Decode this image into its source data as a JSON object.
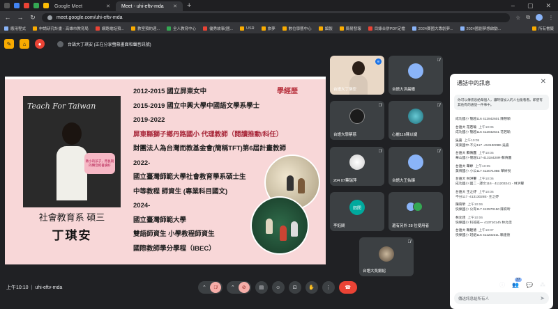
{
  "browser": {
    "tabs": [
      {
        "title": "Google Meet",
        "active": false,
        "favicon": "meet"
      },
      {
        "title": "Meet - uhi-eftv-mda",
        "active": true,
        "favicon": "meet"
      }
    ],
    "url": "meet.google.com/uhi-eftv-mda",
    "bookmarks": [
      "應用程式",
      "申請研究計畫 - 高雄市教育局",
      "網路電話預...",
      "教室預約週...",
      "全人教育中心",
      "優秀故事(國...",
      "USR",
      "旅夢",
      "數位學藝中心",
      "編製",
      "簡易發報",
      "目錄合併PDF定檔",
      "2024賽國大專創夢...",
      "2024國創夢想啟動...",
      "所有書籤"
    ]
  },
  "meet": {
    "presenting_text": "台語大丁琪安 (正在分享螢幕畫面和聲音訊號)",
    "slide": {
      "photo_title": "Teach For Taiwan",
      "sign_text": "教小的孩子，用長期的聲音把書讀好",
      "dept": "社會教育系 碩三",
      "name": "丁琪安",
      "edu_label": "學經歷",
      "lines": [
        {
          "text": "2012-2015 國立屏東女中",
          "red": false
        },
        {
          "text": "2015-2019 國立中興大學中國語文學系學士",
          "red": false
        },
        {
          "text": "2019-2022",
          "red": false
        },
        {
          "text": "屏東縣獅子鄉丹路國小 代理教師（閱讀推動/科任）",
          "red": true
        },
        {
          "text": "財團法人為台灣而教基金會(簡稱TFT)第6屆計畫教師",
          "red": false
        },
        {
          "text": "2022-",
          "red": false
        },
        {
          "text": "國立臺灣師範大學社會教育學系碩士生",
          "red": false
        },
        {
          "text": "中等教程 師資生 (專業科目國文)",
          "red": false
        },
        {
          "text": "2024-",
          "red": false
        },
        {
          "text": "國立臺灣師範大學",
          "red": false
        },
        {
          "text": "雙語師資生 小學教程師資生",
          "red": false
        },
        {
          "text": "國際教師學分學程（IBEC）",
          "red": false
        }
      ]
    },
    "tiles": [
      {
        "name": "台語大丁琪安",
        "type": "self",
        "avatar_color": "#e9d8c6"
      },
      {
        "name": "台語大洪晨瞳",
        "type": "avatar",
        "avatar_color": "#8ab4f8"
      },
      {
        "name": "台語大學蔡慈",
        "type": "avatar",
        "avatar_color": "#1b1b1b"
      },
      {
        "name": "心麗116陳以婕",
        "type": "avatar",
        "avatar_color": "#2c9aa8"
      },
      {
        "name": "204 07葉瑞萍",
        "type": "avatar",
        "avatar_color": "#e8e8e8"
      },
      {
        "name": "台語大王佑臻",
        "type": "avatar",
        "avatar_color": "#8ab4f8"
      },
      {
        "name": "李鈺閔",
        "type": "initials",
        "avatar_color": "#00a99d",
        "initials": "鈺閔"
      },
      {
        "name": "還有另外 28 位使用者",
        "type": "more",
        "avatar_color": "#5f6368"
      },
      {
        "name": "台語大吳銀紹",
        "type": "photo",
        "avatar_color": "#c9b79c"
      }
    ],
    "clock": "上午10:10",
    "meeting_code": "uhi-eftv-mda",
    "participant_count": "37",
    "icons": {
      "mic": "mic-off-icon",
      "camera": "camera-off-icon",
      "captions": "captions-icon",
      "emoji": "emoji-icon",
      "present": "present-icon",
      "hand": "raise-hand-icon",
      "more": "more-vertical-icon",
      "hangup": "hangup-icon"
    },
    "colors": {
      "accent": "#8ab4f8",
      "hangup": "#ea4335",
      "muted_bg": "#f6aea9"
    }
  },
  "chat": {
    "title": "通話中的訊息",
    "notice": "你可以傳訊息給每個人，讓時發加入的人也能看看。即使有其他有的通話一件事中。",
    "messages": [
      {
        "who": "成功國小 簡越116 412842601 陳慈穎",
        "time": "",
        "text": ""
      },
      {
        "who": "台語大 花若瑜",
        "time": "上午10:05",
        "text": "成功國小 簡越116 412842641 花若瑜"
      },
      {
        "who": "吳嘉",
        "time": "上午10:05",
        "text": "東東國中-不分117 -41313008E-吳嘉"
      },
      {
        "who": "台語大 蘇倩圓",
        "time": "上午10:05",
        "text": "華山國小-簡越117-41318420R-蘇倩圓"
      },
      {
        "who": "台語大 華婷",
        "time": "上午10:05",
        "text": "美博國小 小公117 41307108E 華婷悅"
      },
      {
        "who": "台語大 林洪璽",
        "time": "上午10:06",
        "text": "成功國小 國二 - 譯文116 - 411203241 - 林洪璽"
      },
      {
        "who": "台語大 王之妤",
        "time": "上午10:06",
        "text": "不分117 -41313028E- 王之妤"
      },
      {
        "who": "陳育昕",
        "time": "上午10:06",
        "text": "快樂國小 公育117 413570150 陳育昕"
      },
      {
        "who": "林允佳",
        "time": "上午10:06",
        "text": "快樂國小 科班班一 41371014h 林允佳"
      },
      {
        "who": "台語大 賴建德",
        "time": "上午10:07",
        "text": "快樂國小 班組115 41123231L 賴建德"
      }
    ],
    "compose_placeholder": "傳送訊息給所有人"
  }
}
